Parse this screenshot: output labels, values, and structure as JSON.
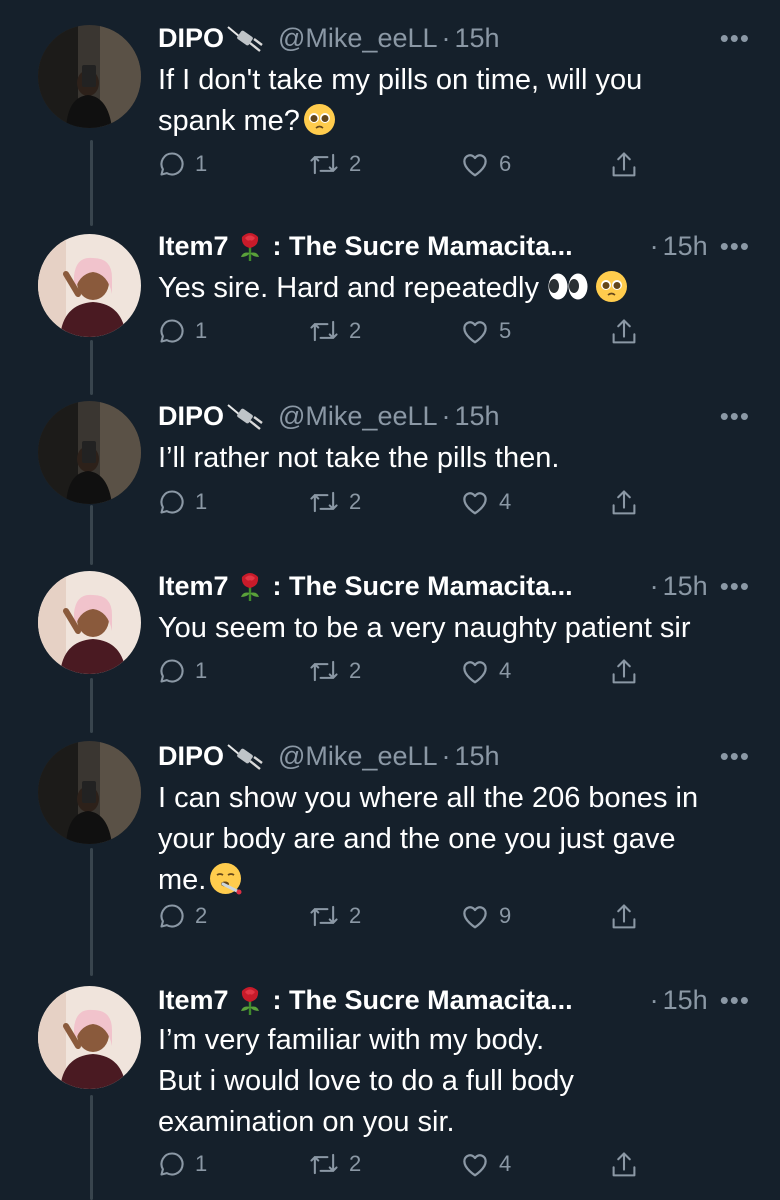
{
  "tweets": [
    {
      "author": "DIPO",
      "name_emoji": "plug-icon",
      "handle": "@Mike_eeLL",
      "time": "15h",
      "separator": "·",
      "lines": [
        "If I don't take my pills on time, will you",
        "spank me?"
      ],
      "trailing_emoji": [
        "pleading-face-emoji"
      ],
      "replies": "1",
      "retweets": "2",
      "likes": "6"
    },
    {
      "author": "Item7",
      "name_emoji": "rose-icon",
      "name_suffix": ": The Sucre Mamacita...",
      "time": "15h",
      "separator": "·",
      "lines": [
        "Yes sire. Hard and repeatedly"
      ],
      "trailing_emoji": [
        "eyes-emoji",
        "pleading-face-emoji"
      ],
      "replies": "1",
      "retweets": "2",
      "likes": "5"
    },
    {
      "author": "DIPO",
      "name_emoji": "plug-icon",
      "handle": "@Mike_eeLL",
      "time": "15h",
      "separator": "·",
      "lines": [
        "I’ll rather not take the pills then."
      ],
      "replies": "1",
      "retweets": "2",
      "likes": "4"
    },
    {
      "author": "Item7",
      "name_emoji": "rose-icon",
      "name_suffix": ": The Sucre Mamacita...",
      "time": "15h",
      "separator": "·",
      "lines": [
        "You seem to be a very naughty patient sir"
      ],
      "replies": "1",
      "retweets": "2",
      "likes": "4"
    },
    {
      "author": "DIPO",
      "name_emoji": "plug-icon",
      "handle": "@Mike_eeLL",
      "time": "15h",
      "separator": "·",
      "lines": [
        "I can show you where all the 206 bones in",
        "your body are and the one you just gave",
        "me."
      ],
      "trailing_emoji": [
        "face-with-thermometer-emoji"
      ],
      "replies": "2",
      "retweets": "2",
      "likes": "9"
    },
    {
      "author": "Item7",
      "name_emoji": "rose-icon",
      "name_suffix": ": The Sucre Mamacita...",
      "time": "15h",
      "separator": "·",
      "lines": [
        "I’m very familiar with my body.",
        "But i would love to do a full body",
        "examination on you sir."
      ],
      "replies": "1",
      "retweets": "2",
      "likes": "4"
    }
  ],
  "colors": {
    "background": "#15202b",
    "text": "#ffffff",
    "secondary": "#8b98a5",
    "thread_line": "#38444d"
  }
}
